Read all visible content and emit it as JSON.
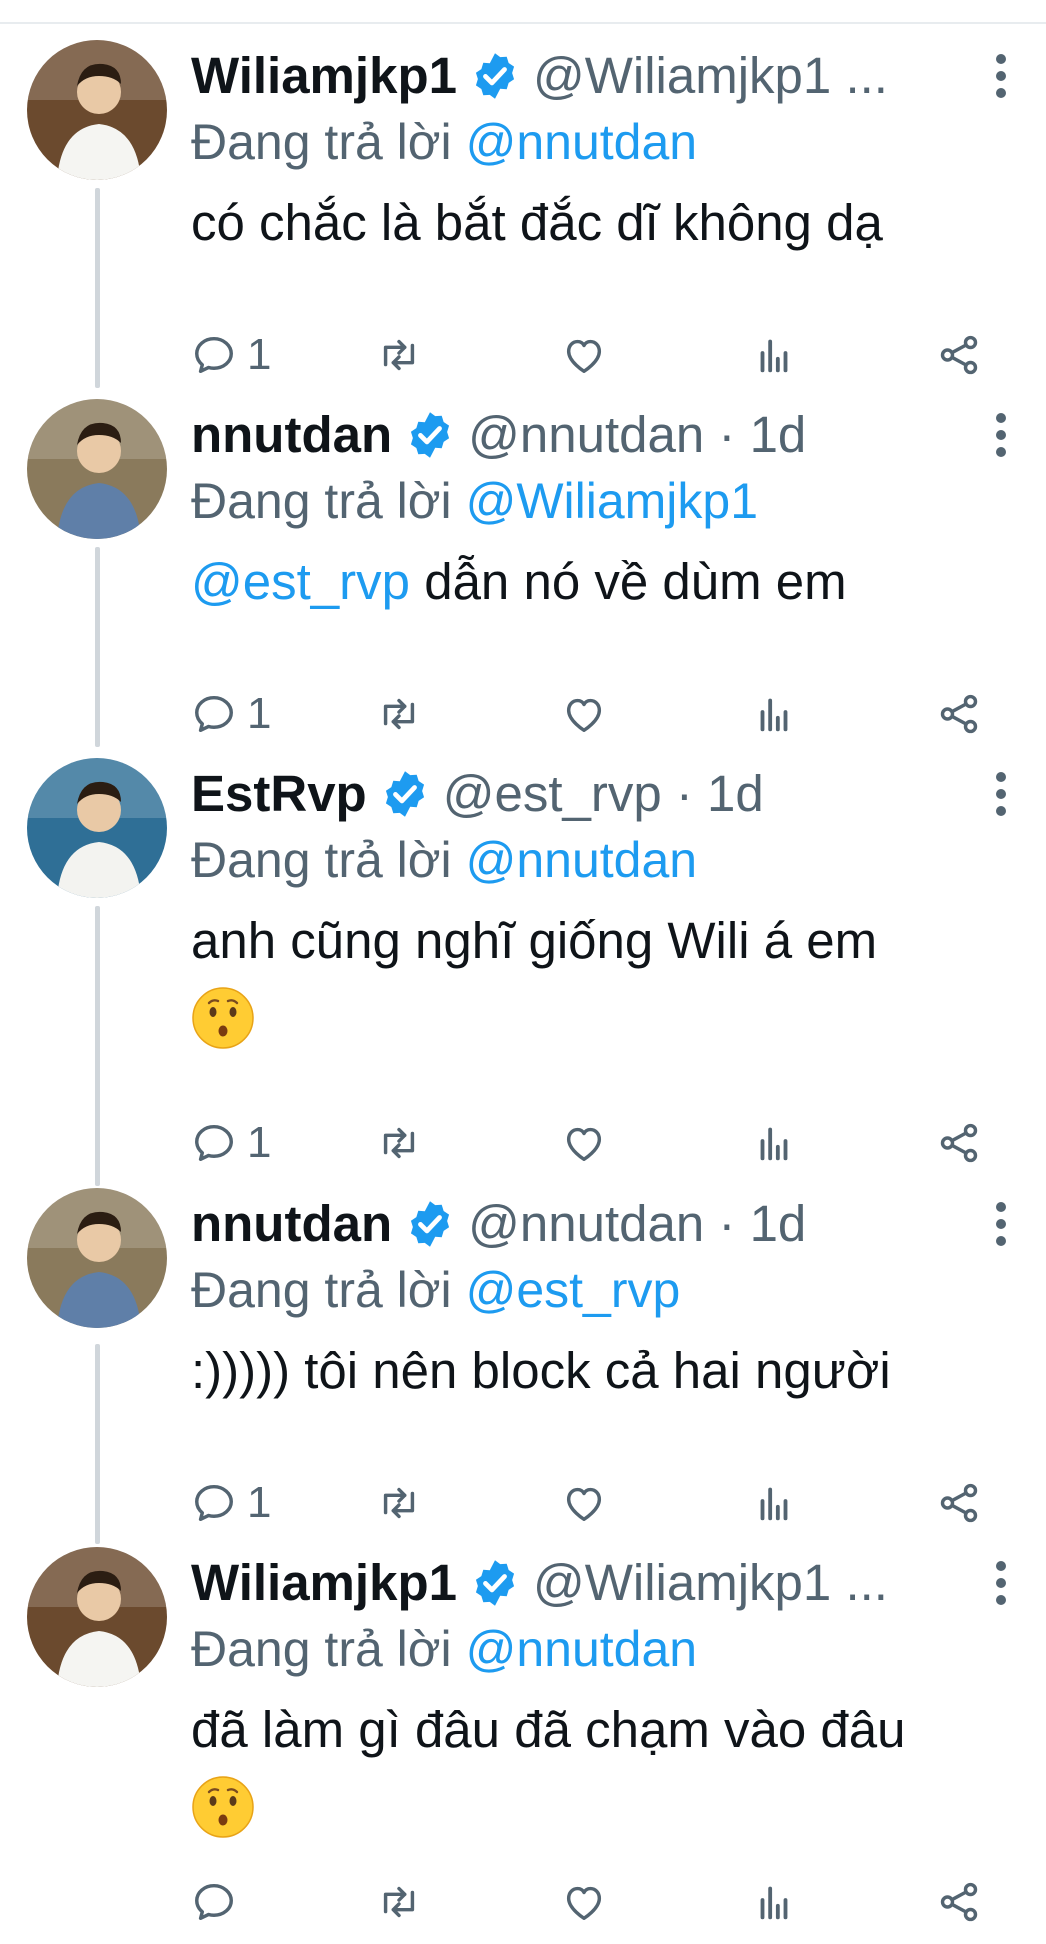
{
  "tweets": [
    {
      "name": "Wiliamjkp1",
      "handle_meta": "@Wiliamjkp1 ...",
      "reply_prefix": "Đang trả lời",
      "reply_to": "@nnutdan",
      "text_mention": "",
      "text": "có chắc là bắt đắc dĩ không dạ",
      "emoji": false,
      "reply_count": "1",
      "avatar_bg": "#6b4a2e"
    },
    {
      "name": "nnutdan",
      "handle_meta": "@nnutdan · 1d",
      "reply_prefix": "Đang trả lời",
      "reply_to": "@Wiliamjkp1",
      "text_mention": "@est_rvp",
      "text": " dẫn nó về dùm em",
      "emoji": false,
      "reply_count": "1",
      "avatar_bg": "#8a7a5c"
    },
    {
      "name": "EstRvp",
      "handle_meta": "@est_rvp · 1d",
      "reply_prefix": "Đang trả lời",
      "reply_to": "@nnutdan",
      "text_mention": "",
      "text": "anh cũng nghĩ giống Wili á em",
      "emoji": true,
      "reply_count": "1",
      "avatar_bg": "#2f6f96"
    },
    {
      "name": "nnutdan",
      "handle_meta": "@nnutdan · 1d",
      "reply_prefix": "Đang trả lời",
      "reply_to": "@est_rvp",
      "text_mention": "",
      "text": ":))))) tôi nên block cả hai người",
      "emoji": false,
      "reply_count": "1",
      "avatar_bg": "#8a7a5c"
    },
    {
      "name": "Wiliamjkp1",
      "handle_meta": "@Wiliamjkp1 ...",
      "reply_prefix": "Đang trả lời",
      "reply_to": "@nnutdan",
      "text_mention": "",
      "text": "đã làm gì đâu đã chạm vào đâu",
      "emoji": true,
      "reply_count": "",
      "avatar_bg": "#6b4a2e"
    }
  ],
  "colors": {
    "accent": "#1d9bf0",
    "muted": "#536471",
    "text": "#0f1419"
  },
  "icons": [
    "reply-icon",
    "retweet-icon",
    "like-icon",
    "views-icon",
    "share-icon",
    "verified-icon",
    "more-icon",
    "kissing-face-emoji"
  ]
}
